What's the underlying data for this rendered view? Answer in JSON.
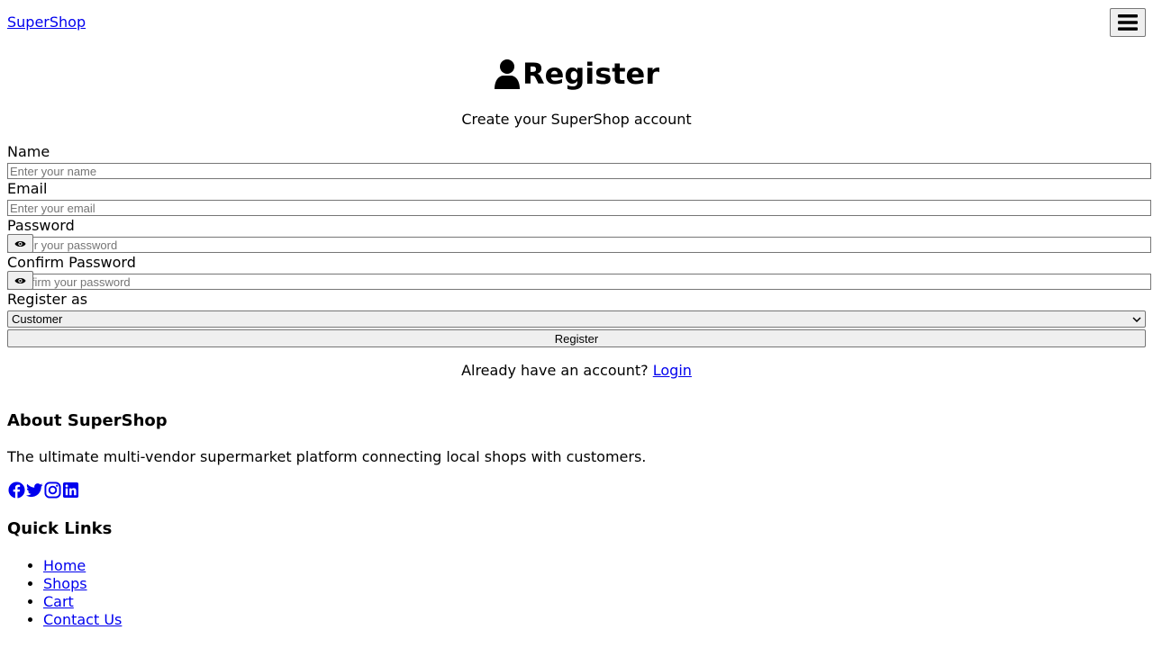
{
  "header": {
    "brand": "SuperShop",
    "menu_icon": "hamburger-menu-icon"
  },
  "page": {
    "title": "Register",
    "title_icon": "user-icon",
    "subtitle": "Create your SuperShop account"
  },
  "form": {
    "name": {
      "label": "Name",
      "placeholder": "Enter your name",
      "value": ""
    },
    "email": {
      "label": "Email",
      "placeholder": "Enter your email",
      "value": ""
    },
    "password": {
      "label": "Password",
      "placeholder": "Enter your password",
      "value": "",
      "toggle_icon": "eye-icon"
    },
    "confirm_password": {
      "label": "Confirm Password",
      "placeholder": "Confirm your password",
      "value": "",
      "toggle_icon": "eye-icon"
    },
    "role": {
      "label": "Register as",
      "selected": "Customer"
    },
    "submit_label": "Register"
  },
  "login_prompt": {
    "text": "Already have an account?",
    "link": "Login"
  },
  "footer": {
    "about": {
      "heading": "About SuperShop",
      "text": "The ultimate multi-vendor supermarket platform connecting local shops with customers."
    },
    "socials": [
      "facebook-icon",
      "twitter-icon",
      "instagram-icon",
      "linkedin-icon"
    ],
    "quick_links": {
      "heading": "Quick Links",
      "items": [
        "Home",
        "Shops",
        "Cart",
        "Contact Us"
      ]
    }
  },
  "colors": {
    "link": "#0000ee",
    "text": "#000000",
    "button_bg": "#efefef",
    "border": "#767676"
  }
}
